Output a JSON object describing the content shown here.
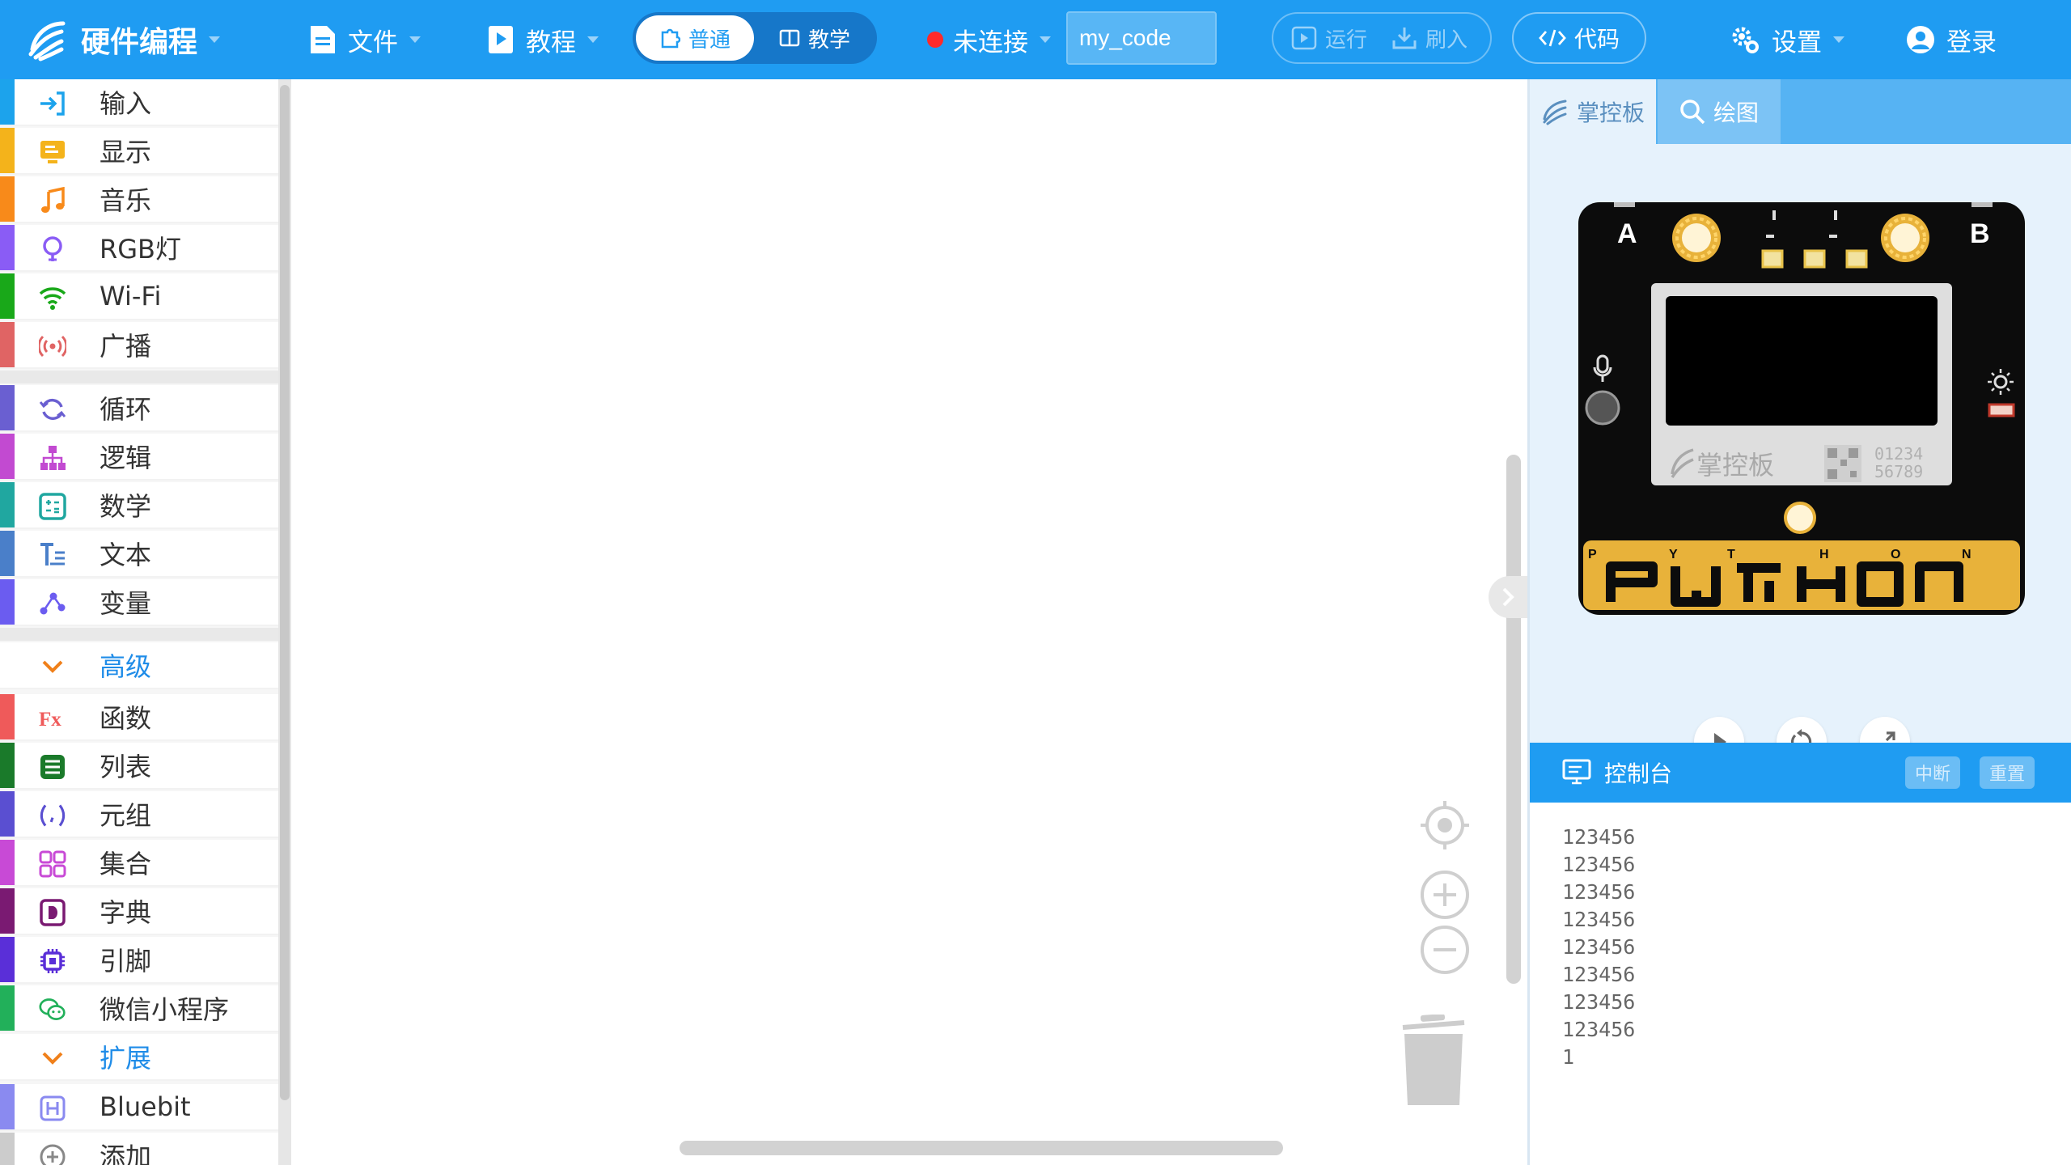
{
  "header": {
    "brand": "硬件编程",
    "menu_file": "文件",
    "menu_tutorial": "教程",
    "mode_normal": "普通",
    "mode_teach": "教学",
    "connection_status": "未连接",
    "filename": "my_code",
    "run_label": "运行",
    "flash_label": "刷入",
    "code_label": "代码",
    "settings_label": "设置",
    "login_label": "登录"
  },
  "colors": {
    "brand_blue": "#1f9cf2",
    "disconnected_red": "#ff2a2a"
  },
  "sidebar": {
    "items": [
      {
        "label": "输入",
        "icon": "input-arrow-icon",
        "color": "#1ca3ec"
      },
      {
        "label": "显示",
        "icon": "display-icon",
        "color": "#f4b31b"
      },
      {
        "label": "音乐",
        "icon": "music-note-icon",
        "color": "#f88a1a"
      },
      {
        "label": "RGB灯",
        "icon": "lightbulb-icon",
        "color": "#8a5cf5"
      },
      {
        "label": "Wi-Fi",
        "icon": "wifi-icon",
        "color": "#19a819"
      },
      {
        "label": "广播",
        "icon": "broadcast-icon",
        "color": "#e06464"
      },
      {
        "label": "循环",
        "icon": "loop-icon",
        "color": "#6a5fd1"
      },
      {
        "label": "逻辑",
        "icon": "logic-tree-icon",
        "color": "#c24ad1"
      },
      {
        "label": "数学",
        "icon": "math-icon",
        "color": "#20a7a0"
      },
      {
        "label": "文本",
        "icon": "text-icon",
        "color": "#4a7fc9"
      },
      {
        "label": "变量",
        "icon": "variable-icon",
        "color": "#6b5cf0"
      },
      {
        "label": "高级",
        "icon": "chevron-down-icon",
        "color": "#f0801a"
      },
      {
        "label": "函数",
        "icon": "function-icon",
        "color": "#ef5a5a"
      },
      {
        "label": "列表",
        "icon": "list-icon",
        "color": "#1a7a2a"
      },
      {
        "label": "元组",
        "icon": "tuple-icon",
        "color": "#5a4fd1"
      },
      {
        "label": "集合",
        "icon": "set-icon",
        "color": "#c84ad6"
      },
      {
        "label": "字典",
        "icon": "dictionary-icon",
        "color": "#7a1a72"
      },
      {
        "label": "引脚",
        "icon": "pin-chip-icon",
        "color": "#5a2fd8"
      },
      {
        "label": "微信小程序",
        "icon": "wechat-icon",
        "color": "#22b05a"
      },
      {
        "label": "扩展",
        "icon": "chevron-down-icon",
        "color": "#f0801a"
      },
      {
        "label": "Bluebit",
        "icon": "bluebit-icon",
        "color": "#8a8af0"
      },
      {
        "label": "添加",
        "icon": "add-circle-icon",
        "color": "#888888"
      }
    ]
  },
  "right_panel": {
    "tab_board": "掌控板",
    "tab_draw": "绘图",
    "board": {
      "button_a": "A",
      "button_b": "B",
      "logo_text": "掌控板",
      "serial_line1": "01234",
      "serial_line2": "56789",
      "pin_letters": [
        "P",
        "Y",
        "T",
        "H",
        "O",
        "N"
      ]
    },
    "console_title": "控制台",
    "console_interrupt": "中断",
    "console_reset": "重置",
    "console_lines": [
      "123456",
      "123456",
      "123456",
      "123456",
      "123456",
      "123456",
      "123456",
      "123456",
      "1"
    ]
  }
}
